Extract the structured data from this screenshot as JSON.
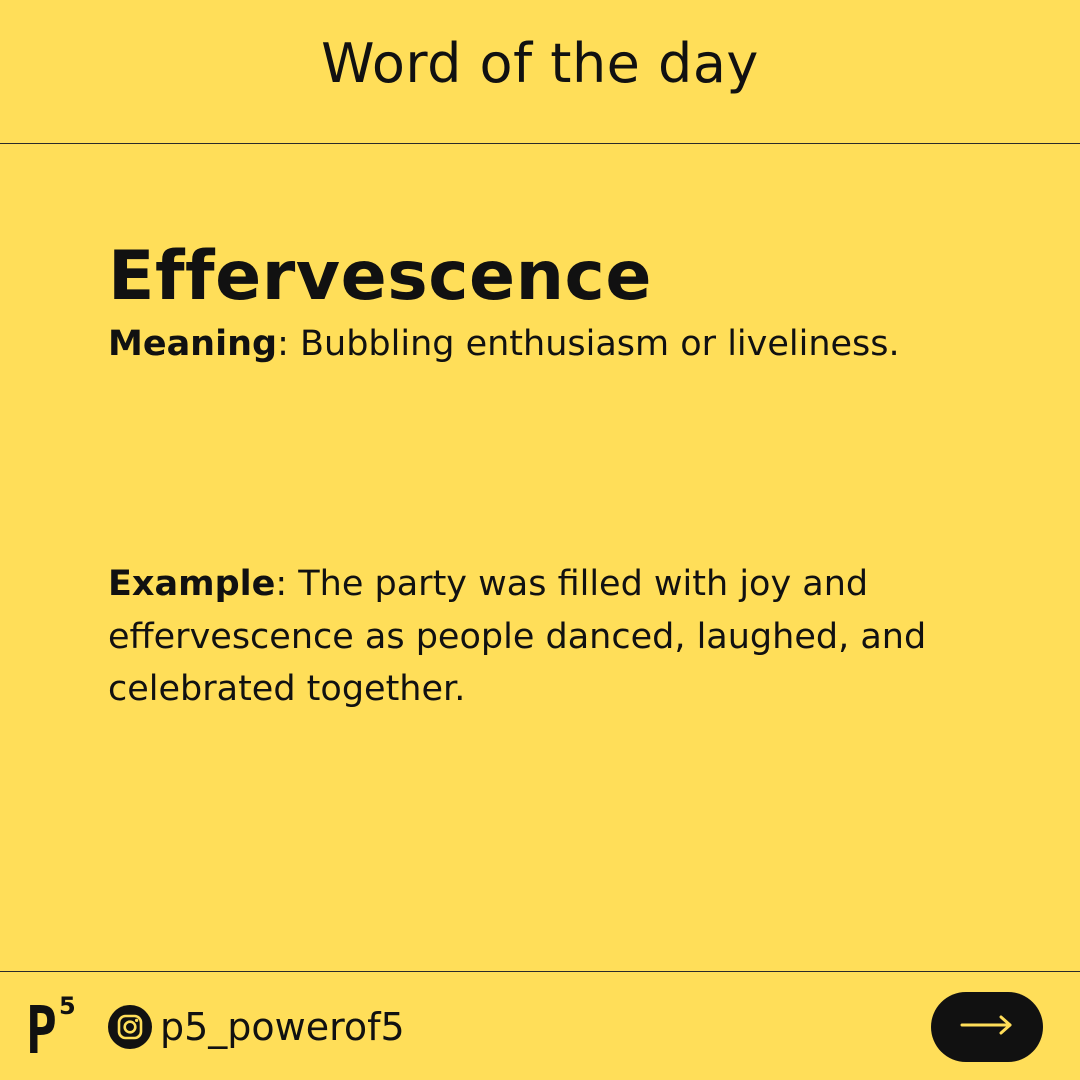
{
  "header": {
    "title": "Word of the day"
  },
  "entry": {
    "word": "Effervescence",
    "meaning_label": "Meaning",
    "meaning_text": ": Bubbling enthusiasm or liveliness.",
    "example_label": "Example",
    "example_text": ": The party was filled with joy and effervescence as people danced, laughed, and celebrated together."
  },
  "footer": {
    "logo": {
      "letter": "P",
      "superscript": "5"
    },
    "social_icon": "instagram-icon",
    "handle": "p5_powerof5",
    "next_icon": "arrow-right-icon"
  },
  "colors": {
    "background": "#FFDE59",
    "text": "#111111",
    "button": "#111111",
    "button_icon": "#FFDE59"
  }
}
